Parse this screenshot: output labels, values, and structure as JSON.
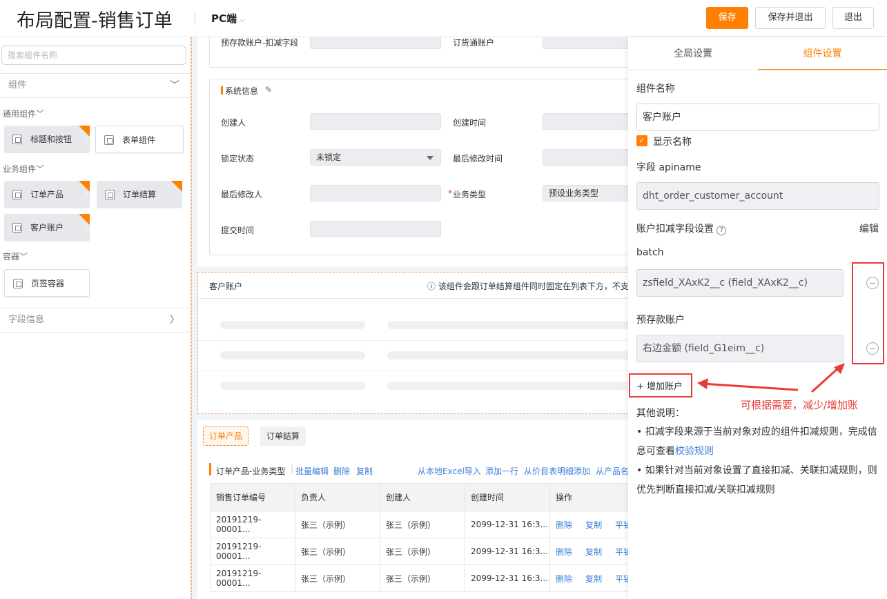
{
  "header": {
    "title": "布局配置-销售订单",
    "device": "PC端",
    "save": "保存",
    "save_exit": "保存并退出",
    "exit": "退出"
  },
  "sidebar": {
    "search_placeholder": "搜索组件名称",
    "section_components": "组件",
    "group_general": "通用组件",
    "group_business": "业务组件",
    "group_container": "容器",
    "items": {
      "title_button": "标题和按钮",
      "form": "表单组件",
      "order_product": "订单产品",
      "order_settle": "订单结算",
      "customer_account": "客户账户",
      "tab_container": "页签容器"
    },
    "section_fields": "字段信息"
  },
  "canvas": {
    "top_row": {
      "label1": "预存款账户-扣减字段",
      "label2": "订货通账户"
    },
    "sysinfo": {
      "title": "系统信息",
      "creator": "创建人",
      "create_time": "创建时间",
      "lock_status": "锁定状态",
      "lock_value": "未锁定",
      "last_modified_time": "最后修改时间",
      "last_modifier": "最后修改人",
      "required_mark": "*",
      "biz_type": "业务类型",
      "biz_type_value": "预设业务类型",
      "submit_time": "提交时间"
    },
    "account": {
      "title": "客户账户",
      "warning": "ⓘ 该组件会跟订单结算组件同时固定在列表下方，不支"
    },
    "tabs": {
      "product": "订单产品",
      "settle": "订单结算"
    },
    "products": {
      "title": "订单产品-业务类型",
      "batch_edit": "批量编辑",
      "delete": "删除",
      "copy": "复制",
      "excel_import": "从本地Excel导入",
      "add_row": "添加一行",
      "add_from_price": "从价目表明细添加",
      "from_product": "从产品名",
      "columns": [
        "销售订单编号",
        "负责人",
        "创建人",
        "创建时间",
        "操作"
      ],
      "rows": [
        [
          "20191219-00001...",
          "张三（示例）",
          "张三（示例）",
          "2099-12-31 16:3..."
        ],
        [
          "20191219-00001...",
          "张三（示例）",
          "张三（示例）",
          "2099-12-31 16:3..."
        ],
        [
          "20191219-00001...",
          "张三（示例）",
          "张三（示例）",
          "2099-12-31 16:3..."
        ]
      ],
      "op_delete": "删除",
      "op_copy": "复制",
      "op_more": "平铺"
    }
  },
  "panel": {
    "tab_global": "全局设置",
    "tab_component": "组件设置",
    "name_label": "组件名称",
    "name_value": "客户账户",
    "show_name": "显示名称",
    "show_name_checked": true,
    "apiname_label": "字段 apiname",
    "apiname_value": "dht_order_customer_account",
    "deduct_label": "账户扣减字段设置",
    "edit": "编辑",
    "batch_label": "batch",
    "batch_value": "zsfield_XAxK2__c (field_XAxK2__c)",
    "prepay_label": "预存款账户",
    "prepay_value": "右边金额 (field_G1eim__c)",
    "add_account": "+ 增加账户",
    "annotation": "可根据需要，减少/增加账",
    "other_title": "其他说明：",
    "note1_a": "• 扣减字段来源于当前对象对应的组件扣减规则，完成信息可查看",
    "note1_link": "校验规则",
    "note2": "• 如果针对当前对象设置了直接扣减、关联扣减规则，则优先判断直接扣减/关联扣减规则"
  },
  "colors": {
    "accent": "#ff8000",
    "link": "#3c7fd9",
    "annotation": "#e83b35"
  }
}
